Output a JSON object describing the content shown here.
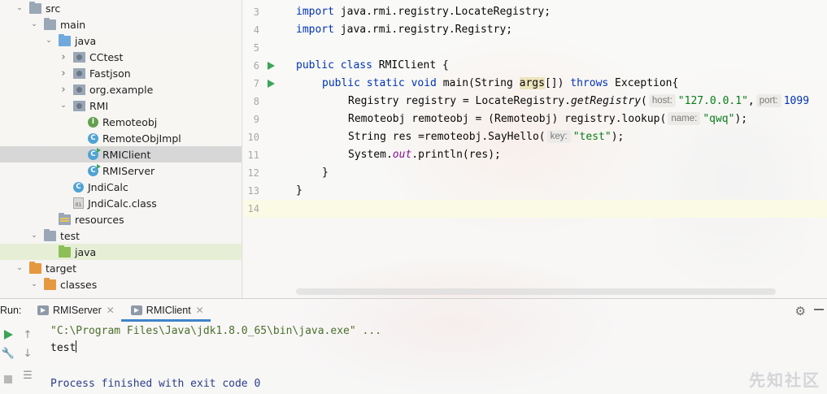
{
  "project_tree": [
    {
      "label": "src",
      "indent": 0,
      "icon": "folder-icon",
      "chevron": "down"
    },
    {
      "label": "main",
      "indent": 1,
      "icon": "folder-icon",
      "chevron": "down"
    },
    {
      "label": "java",
      "indent": 2,
      "icon": "source-folder-icon",
      "chevron": "down"
    },
    {
      "label": "CCtest",
      "indent": 3,
      "icon": "package-icon",
      "chevron": "right"
    },
    {
      "label": "Fastjson",
      "indent": 3,
      "icon": "package-icon",
      "chevron": "right"
    },
    {
      "label": "org.example",
      "indent": 3,
      "icon": "package-icon",
      "chevron": "right"
    },
    {
      "label": "RMI",
      "indent": 3,
      "icon": "package-icon",
      "chevron": "down"
    },
    {
      "label": "Remoteobj",
      "indent": 4,
      "icon": "interface-icon",
      "chevron": ""
    },
    {
      "label": "RemoteObjImpl",
      "indent": 4,
      "icon": "class-icon",
      "chevron": ""
    },
    {
      "label": "RMIClient",
      "indent": 4,
      "icon": "runnable-class-icon",
      "chevron": "",
      "selected": true
    },
    {
      "label": "RMIServer",
      "indent": 4,
      "icon": "runnable-class-icon",
      "chevron": ""
    },
    {
      "label": "JndiCalc",
      "indent": 3,
      "icon": "class-icon",
      "chevron": ""
    },
    {
      "label": "JndiCalc.class",
      "indent": 3,
      "icon": "binary-file-icon",
      "chevron": ""
    },
    {
      "label": "resources",
      "indent": 2,
      "icon": "resources-folder-icon",
      "chevron": ""
    },
    {
      "label": "test",
      "indent": 1,
      "icon": "folder-icon",
      "chevron": "down"
    },
    {
      "label": "java",
      "indent": 2,
      "icon": "test-folder-icon",
      "chevron": "",
      "highlight": true
    },
    {
      "label": "target",
      "indent": 0,
      "icon": "excluded-folder-icon",
      "chevron": "down"
    },
    {
      "label": "classes",
      "indent": 1,
      "icon": "excluded-folder-icon",
      "chevron": "down"
    }
  ],
  "editor": {
    "line_numbers": [
      "3",
      "4",
      "5",
      "6",
      "7",
      "8",
      "9",
      "10",
      "11",
      "12",
      "13",
      "14"
    ],
    "lines": {
      "l3_kw": "import",
      "l3_rest": " java.rmi.registry.LocateRegistry;",
      "l4_kw": "import",
      "l4_rest": " java.rmi.registry.Registry;",
      "l6_kw": "public class",
      "l6_rest": " RMIClient {",
      "l7_kw1": "public static void",
      "l7_mid": " main(String ",
      "l7_param": "args",
      "l7_mid2": "[]) ",
      "l7_kw2": "throws",
      "l7_end": " Exception{",
      "l8_a": "Registry registry = LocateRegistry.",
      "l8_fn": "getRegistry",
      "l8_b": "(",
      "l8_hint1": "host:",
      "l8_str": "\"127.0.0.1\"",
      "l8_c": ",",
      "l8_hint2": "port:",
      "l8_num": "1099",
      "l9_a": "Remoteobj remoteobj = (Remoteobj) registry.lookup(",
      "l9_hint": "name:",
      "l9_str": "\"qwq\"",
      "l9_end": ");",
      "l10_a": "String res =remoteobj.SayHello(",
      "l10_hint": "key:",
      "l10_str": "\"test\"",
      "l10_end": ");",
      "l11_a": "System.",
      "l11_fld": "out",
      "l11_b": ".println(res);",
      "l12": "}",
      "l13": "}"
    }
  },
  "run_panel": {
    "label": "Run:",
    "tabs": [
      {
        "label": "RMIServer",
        "active": false
      },
      {
        "label": "RMIClient",
        "active": true
      }
    ],
    "console": {
      "command": "\"C:\\Program Files\\Java\\jdk1.8.0_65\\bin\\java.exe\" ...",
      "output": "test",
      "finished": "Process finished with exit code 0"
    }
  },
  "watermark": "先知社区",
  "colors": {
    "keyword": "#0033b3",
    "string": "#067d17",
    "field": "#871094",
    "selection": "#d7d7d7",
    "accent": "#4083c9"
  }
}
